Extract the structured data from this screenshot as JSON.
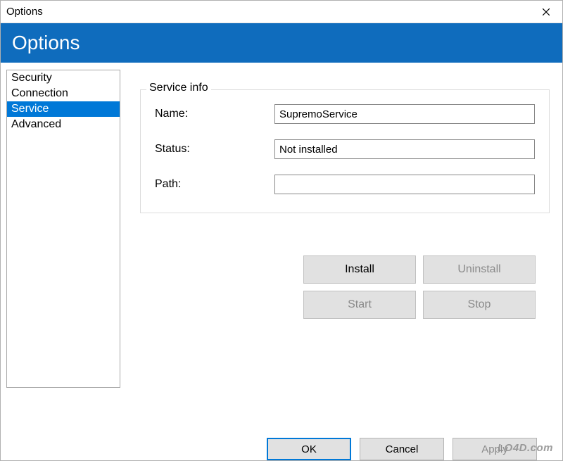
{
  "titlebar": {
    "title": "Options"
  },
  "header": {
    "title": "Options"
  },
  "sidebar": {
    "items": [
      {
        "label": "Security",
        "selected": false
      },
      {
        "label": "Connection",
        "selected": false
      },
      {
        "label": "Service",
        "selected": true
      },
      {
        "label": "Advanced",
        "selected": false
      }
    ]
  },
  "service_info": {
    "group_label": "Service info",
    "name_label": "Name:",
    "name_value": "SupremoService",
    "status_label": "Status:",
    "status_value": "Not installed",
    "path_label": "Path:",
    "path_value": ""
  },
  "service_buttons": {
    "install": "Install",
    "uninstall": "Uninstall",
    "start": "Start",
    "stop": "Stop"
  },
  "dialog_buttons": {
    "ok": "OK",
    "cancel": "Cancel",
    "apply": "Apply"
  },
  "watermark": "LO4D.com"
}
